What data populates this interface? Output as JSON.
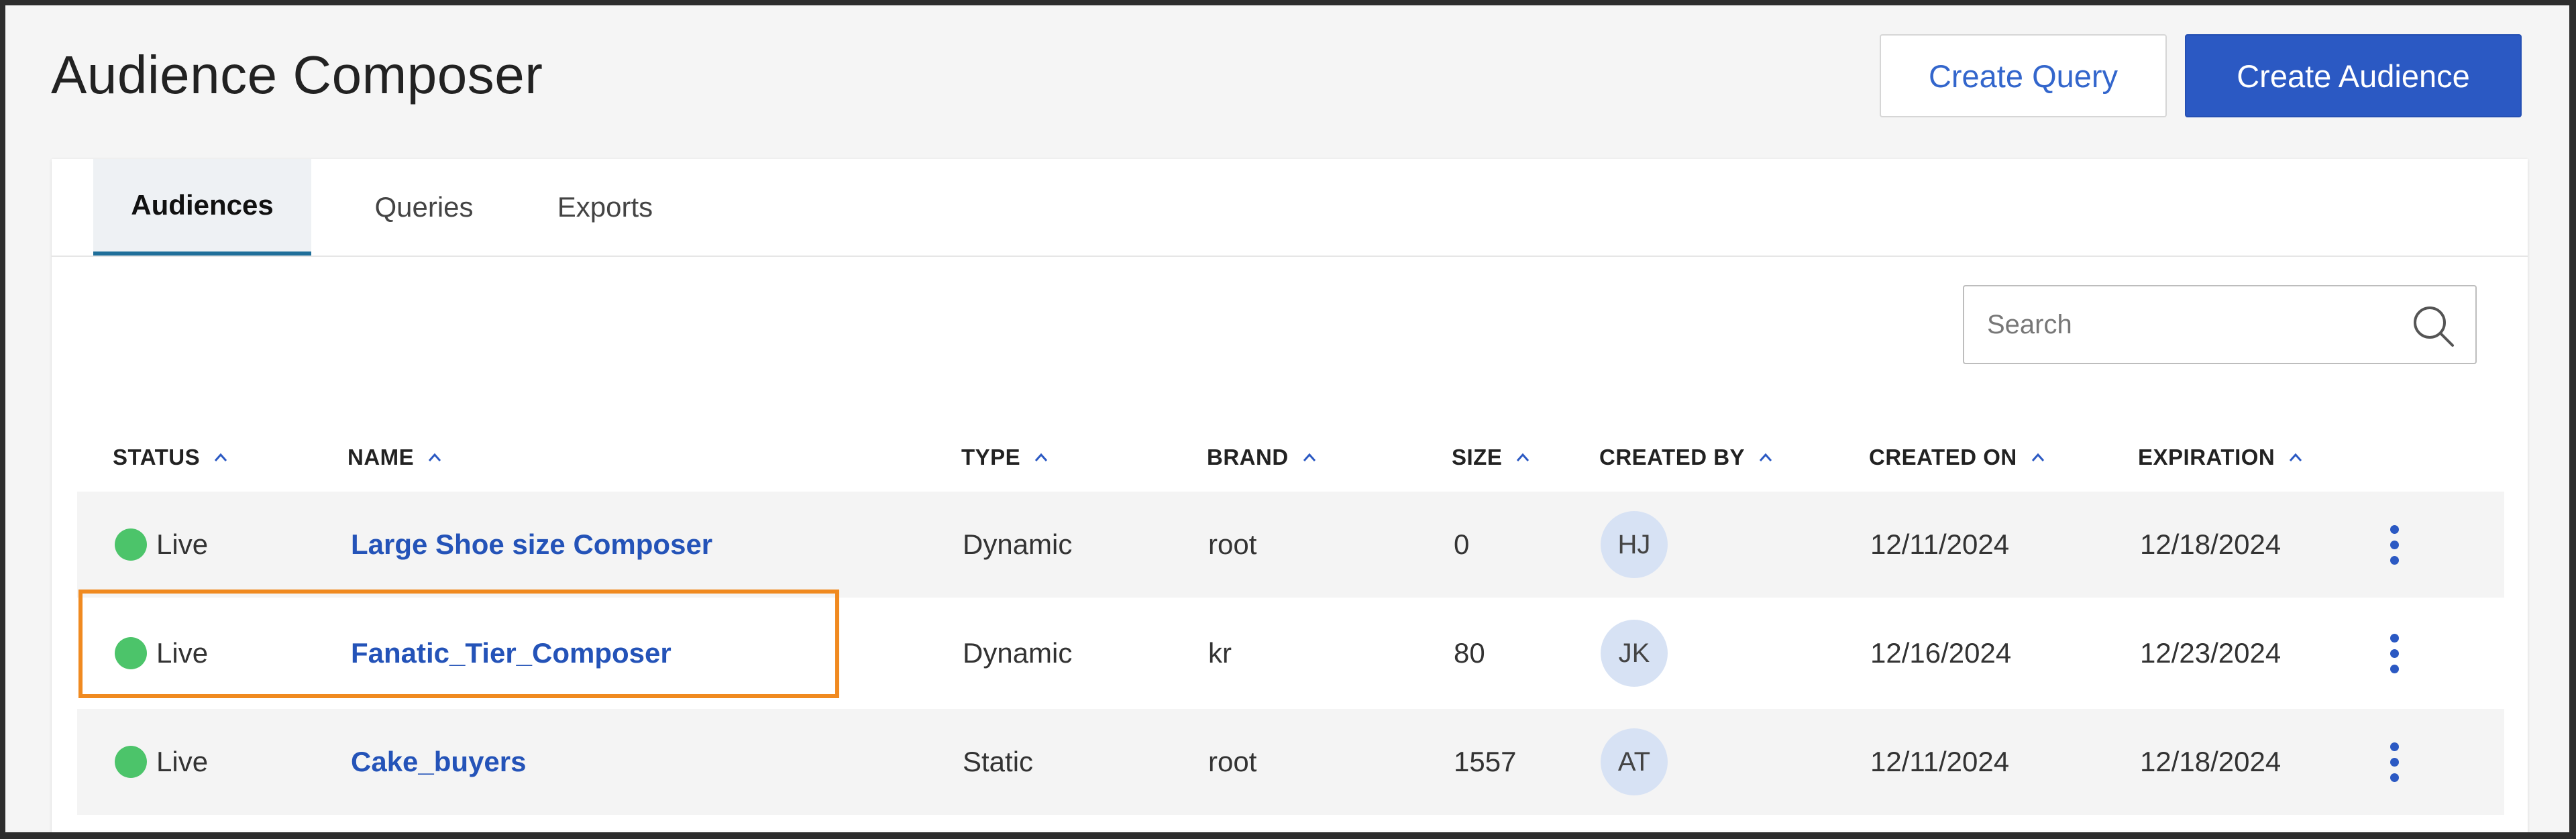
{
  "page": {
    "title": "Audience Composer"
  },
  "header": {
    "create_query_label": "Create Query",
    "create_audience_label": "Create Audience"
  },
  "tabs": [
    {
      "label": "Audiences",
      "active": true
    },
    {
      "label": "Queries",
      "active": false
    },
    {
      "label": "Exports",
      "active": false
    }
  ],
  "search": {
    "placeholder": "Search",
    "value": ""
  },
  "columns": [
    "STATUS",
    "NAME",
    "TYPE",
    "BRAND",
    "SIZE",
    "CREATED BY",
    "CREATED ON",
    "EXPIRATION"
  ],
  "rows": [
    {
      "status": "Live",
      "name": "Large Shoe size Composer",
      "type": "Dynamic",
      "brand": "root",
      "size": "0",
      "created_by": "HJ",
      "created_on": "12/11/2024",
      "expiration": "12/18/2024"
    },
    {
      "status": "Live",
      "name": "Fanatic_Tier_Composer",
      "type": "Dynamic",
      "brand": "kr",
      "size": "80",
      "created_by": "JK",
      "created_on": "12/16/2024",
      "expiration": "12/23/2024"
    },
    {
      "status": "Live",
      "name": "Cake_buyers",
      "type": "Static",
      "brand": "root",
      "size": "1557",
      "created_by": "AT",
      "created_on": "12/11/2024",
      "expiration": "12/18/2024"
    }
  ],
  "icons": {
    "search": "search-icon",
    "sort": "chevron-up-icon",
    "row_menu": "kebab-menu-icon",
    "status": "status-dot-icon"
  },
  "colors": {
    "primary": "#2b59c3",
    "link": "#2453b8",
    "live_status": "#4cc46a",
    "tab_indicator": "#1f6f9a",
    "highlight": "#f08a20"
  }
}
